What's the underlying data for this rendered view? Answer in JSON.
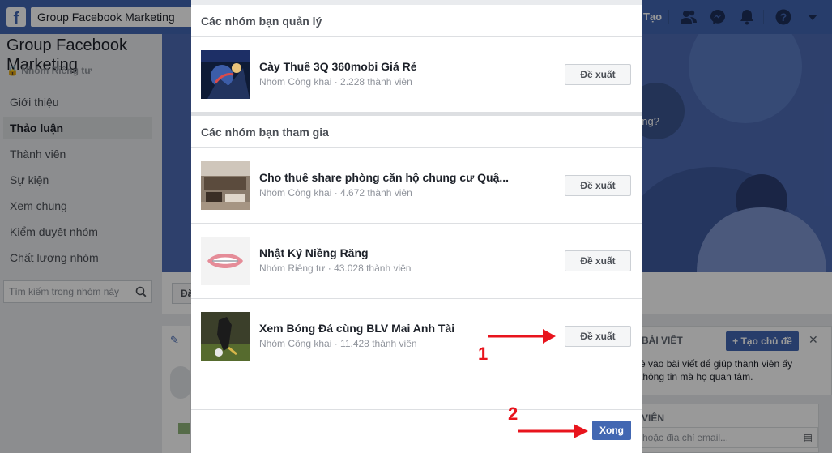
{
  "topbar": {
    "logo": "f",
    "search_value": "Group Facebook Marketing",
    "create_label": "Tạo",
    "icons": [
      "friends-icon",
      "messenger-icon",
      "notifications-icon",
      "help-icon",
      "dropdown-icon"
    ],
    "brand_color": "#4267b2"
  },
  "group": {
    "name": "Group Facebook Marketing",
    "privacy": "Nhóm Riêng tư"
  },
  "sidebar": {
    "items": [
      {
        "label": "Giới thiệu"
      },
      {
        "label": "Thảo luận"
      },
      {
        "label": "Thành viên"
      },
      {
        "label": "Sự kiện"
      },
      {
        "label": "Xem chung"
      },
      {
        "label": "Kiểm duyệt nhóm"
      },
      {
        "label": "Chất lượng nhóm"
      }
    ],
    "active_index": 1,
    "search_placeholder": "Tìm kiếm trong nhóm này"
  },
  "background_fragments": {
    "cover_text": "ông?",
    "discuss_button": "Đă",
    "topics_header": "BÀI VIẾT",
    "create_topic_button": "+ Tạo chủ đề",
    "topics_text": "ề vào bài viết để giúp thành viên ấy thông tin mà họ quan tâm.",
    "members_header": "VIÊN",
    "email_placeholder": "hoặc địa chỉ email..."
  },
  "modal": {
    "sections": [
      {
        "title": "Các nhóm bạn quản lý",
        "groups": [
          {
            "name": "Cày Thuê 3Q 360mobi Giá Rẻ",
            "meta": "Nhóm Công khai · 2.228 thành viên",
            "button": "Đề xuất"
          }
        ]
      },
      {
        "title": "Các nhóm bạn tham gia",
        "groups": [
          {
            "name": "Cho thuê share phòng căn hộ chung cư Quậ...",
            "meta": "Nhóm Công khai · 4.672 thành viên",
            "button": "Đề xuất"
          },
          {
            "name": "Nhật Ký Niềng Răng",
            "meta": "Nhóm Riêng tư · 43.028 thành viên",
            "button": "Đề xuất"
          },
          {
            "name": "Xem Bóng Đá cùng BLV Mai Anh Tài",
            "meta": "Nhóm Công khai · 11.428 thành viên",
            "button": "Đề xuất"
          }
        ]
      }
    ],
    "done_label": "Xong"
  },
  "annotations": [
    {
      "number": "1"
    },
    {
      "number": "2"
    }
  ],
  "colors": {
    "annotation": "#e8141d",
    "primary_button": "#4267b2"
  }
}
